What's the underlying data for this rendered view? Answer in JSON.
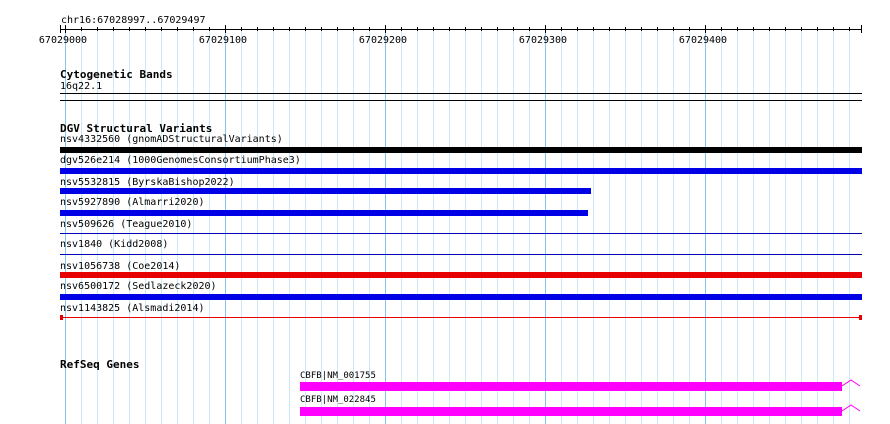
{
  "ruler": {
    "location": "chr16:67028997..67029497",
    "ticks": [
      "67029000",
      "67029100",
      "67029200",
      "67029300",
      "67029400"
    ]
  },
  "tracks": {
    "cytoband": {
      "title": "Cytogenetic Bands",
      "band": "16q22.1"
    },
    "dgv": {
      "title": "DGV Structural Variants",
      "features": [
        {
          "label": "nsv4332560 (gnomADStructuralVariants)",
          "color": "#000000",
          "style": "bar"
        },
        {
          "label": "dgv526e214 (1000GenomesConsortiumPhase3)",
          "color": "#0000e6",
          "style": "bar"
        },
        {
          "label": "nsv5532815 (ByrskaBishop2022)",
          "color": "#0000e6",
          "style": "bar"
        },
        {
          "label": "nsv5927890 (Almarri2020)",
          "color": "#0000e6",
          "style": "bar"
        },
        {
          "label": "nsv509626 (Teague2010)",
          "color": "#0000b4",
          "style": "line"
        },
        {
          "label": "nsv1840 (Kidd2008)",
          "color": "#0000b4",
          "style": "line"
        },
        {
          "label": "nsv1056738 (Coe2014)",
          "color": "#e60000",
          "style": "bar"
        },
        {
          "label": "nsv6500172 (Sedlazeck2020)",
          "color": "#0000e6",
          "style": "bar"
        },
        {
          "label": "nsv1143825 (Alsmadi2014)",
          "color": "#e60000",
          "style": "thin"
        }
      ]
    },
    "refseq": {
      "title": "RefSeq Genes",
      "genes": [
        {
          "label": "CBFB|NM_001755",
          "color": "#ff00ff"
        },
        {
          "label": "CBFB|NM_022845",
          "color": "#ff00ff"
        }
      ]
    }
  }
}
